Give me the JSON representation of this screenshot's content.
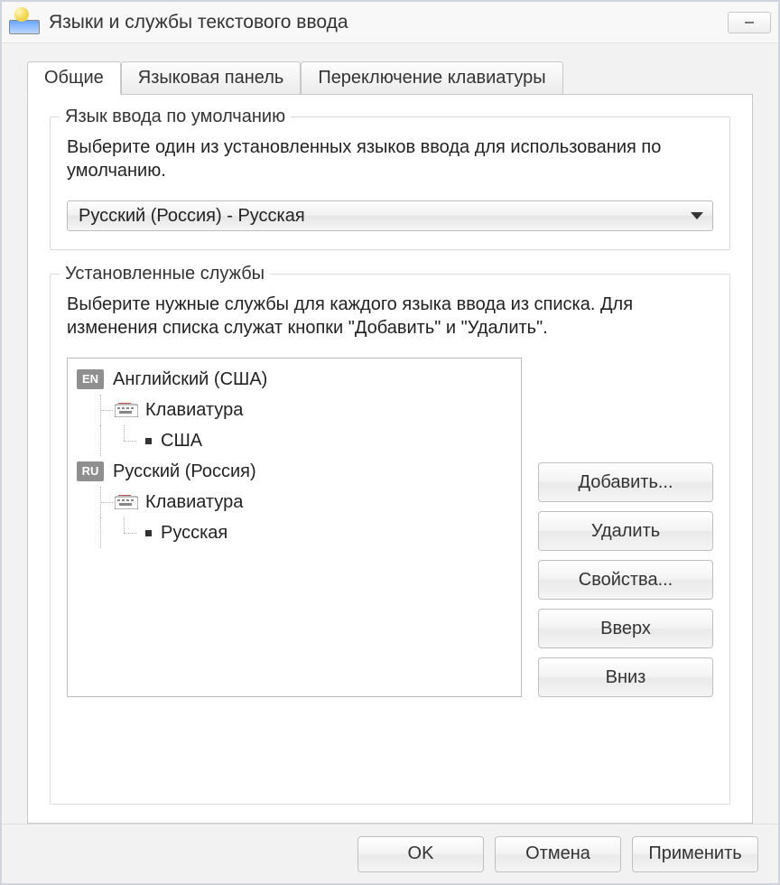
{
  "window": {
    "title": "Языки и службы текстового ввода"
  },
  "tabs": [
    {
      "label": "Общие",
      "active": true
    },
    {
      "label": "Языковая панель",
      "active": false
    },
    {
      "label": "Переключение клавиатуры",
      "active": false
    }
  ],
  "default_lang": {
    "legend": "Язык ввода по умолчанию",
    "desc": "Выберите один из установленных языков ввода для использования по умолчанию.",
    "selected": "Русский (Россия) - Русская"
  },
  "services": {
    "legend": "Установленные службы",
    "desc": "Выберите нужные службы для каждого языка ввода из списка. Для изменения списка служат кнопки \"Добавить\" и \"Удалить\".",
    "langs": [
      {
        "tag": "EN",
        "name": "Английский (США)",
        "category": "Клавиатура",
        "layout": "США"
      },
      {
        "tag": "RU",
        "name": "Русский (Россия)",
        "category": "Клавиатура",
        "layout": "Русская"
      }
    ],
    "buttons": {
      "add": "Добавить...",
      "remove": "Удалить",
      "properties": "Свойства...",
      "up": "Вверх",
      "down": "Вниз"
    }
  },
  "dialog_buttons": {
    "ok": "OK",
    "cancel": "Отмена",
    "apply": "Применить"
  }
}
